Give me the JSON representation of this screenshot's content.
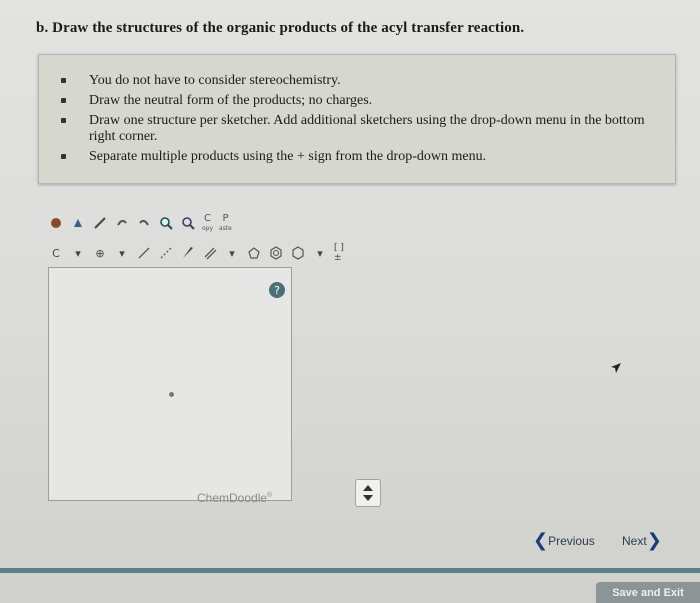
{
  "question": {
    "text": "b. Draw the structures of the organic products of the acyl transfer reaction."
  },
  "instructions": [
    "You do not have to consider stereochemistry.",
    "Draw the neutral form of the products; no charges.",
    "Draw one structure per sketcher. Add additional sketchers using the drop-down menu in the bottom right corner.",
    "Separate multiple products using the + sign from the drop-down menu."
  ],
  "toolbar": {
    "copy_label": "C",
    "copy_sub": "opy",
    "paste_label": "P",
    "paste_sub": "aste",
    "element_label": "C",
    "charge_label": "⊕",
    "bracket_label": "[ ]±"
  },
  "sketcher": {
    "help_label": "?",
    "brand": "ChemDoodle",
    "brand_mark": "®"
  },
  "navigation": {
    "previous": "Previous",
    "next": "Next",
    "save_exit": "Save and Exit"
  },
  "icons": {
    "undo": "undo-icon",
    "redo": "redo-icon",
    "eraser": "eraser-icon",
    "zoom_in": "zoom-in-icon",
    "zoom_out": "zoom-out-icon"
  }
}
